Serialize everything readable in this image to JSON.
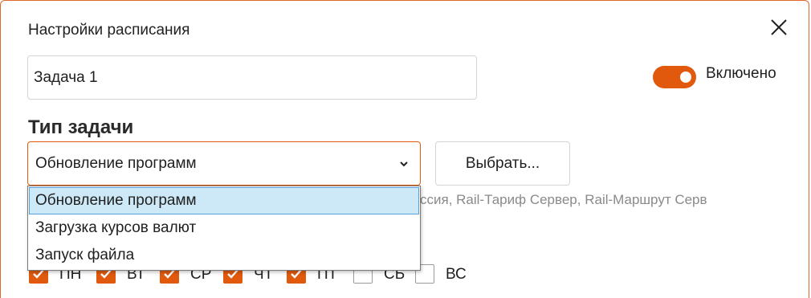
{
  "dialog": {
    "title": "Настройки расписания",
    "close_icon": "close-icon"
  },
  "task_name": {
    "value": "Задача 1"
  },
  "enabled_toggle": {
    "label": "Включено",
    "on": true,
    "color": "#e0590d"
  },
  "task_type": {
    "heading": "Тип задачи",
    "selected": "Обновление программ",
    "choose_button": "Выбрать...",
    "options": [
      "Обновление программ",
      "Загрузка курсов валют",
      "Запуск файла"
    ],
    "products_text": "ссия, Rail-Тариф Сервер, Rail-Маршрут Серв"
  },
  "days": [
    {
      "label": "ПН",
      "checked": true
    },
    {
      "label": "ВТ",
      "checked": true
    },
    {
      "label": "СР",
      "checked": true
    },
    {
      "label": "ЧТ",
      "checked": true
    },
    {
      "label": "ПТ",
      "checked": true
    },
    {
      "label": "СБ",
      "checked": false
    },
    {
      "label": "ВС",
      "checked": false
    }
  ],
  "colors": {
    "accent": "#e0590d",
    "selection": "#cde8f6"
  }
}
